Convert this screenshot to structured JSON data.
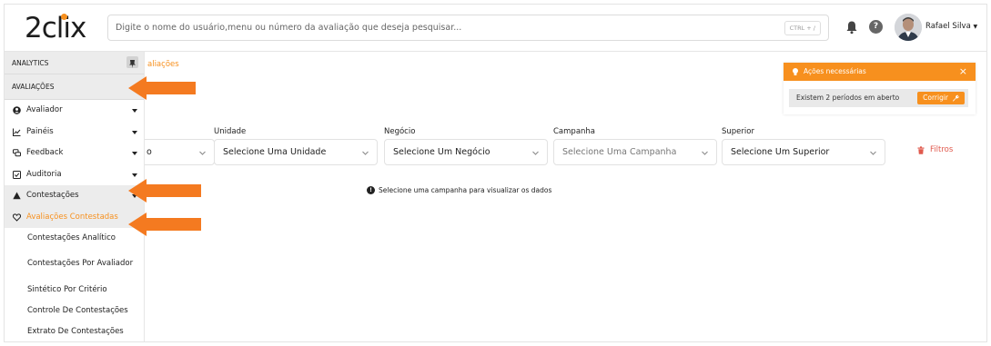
{
  "header": {
    "logo": "2clix",
    "search_placeholder": "Digite o nome do usuário,menu ou número da avaliação que deseja pesquisar...",
    "shortcut": "CTRL + /",
    "help": "?",
    "user_name": "Rafael Silva"
  },
  "sidebar": {
    "analytics_label": "ANALYTICS",
    "avaliacoes_label": "AVALIAÇÕES",
    "items": [
      {
        "label": "Avaliador"
      },
      {
        "label": "Painéis"
      },
      {
        "label": "Feedback"
      },
      {
        "label": "Auditoria"
      },
      {
        "label": "Contestações"
      }
    ],
    "subitems": [
      {
        "label": "Avaliações Contestadas"
      },
      {
        "label": "Contestações Analítico"
      },
      {
        "label": "Contestações Por Avaliador"
      },
      {
        "label": "Sintético Por Critério"
      },
      {
        "label": "Controle De Contestações"
      },
      {
        "label": "Extrato De Contestações"
      }
    ]
  },
  "main": {
    "breadcrumb": "aliações",
    "filters": [
      {
        "label": "Unidade",
        "value": "Selecione Uma Unidade"
      },
      {
        "label": "Negócio",
        "value": "Selecione Um Negócio"
      },
      {
        "label": "Campanha",
        "value": "Selecione Uma Campanha"
      },
      {
        "label": "Superior",
        "value": "Selecione Um Superior"
      }
    ],
    "first_select_fragment": "o",
    "filters_link": "Filtros",
    "info_message": "Selecione uma campanha para visualizar os dados"
  },
  "alert": {
    "title": "Ações necessárias",
    "close": "×",
    "message": "Existem 2 períodos em aberto",
    "button": "Corrigir"
  },
  "colors": {
    "accent": "#f7901e",
    "filters": "#e05a4e"
  }
}
